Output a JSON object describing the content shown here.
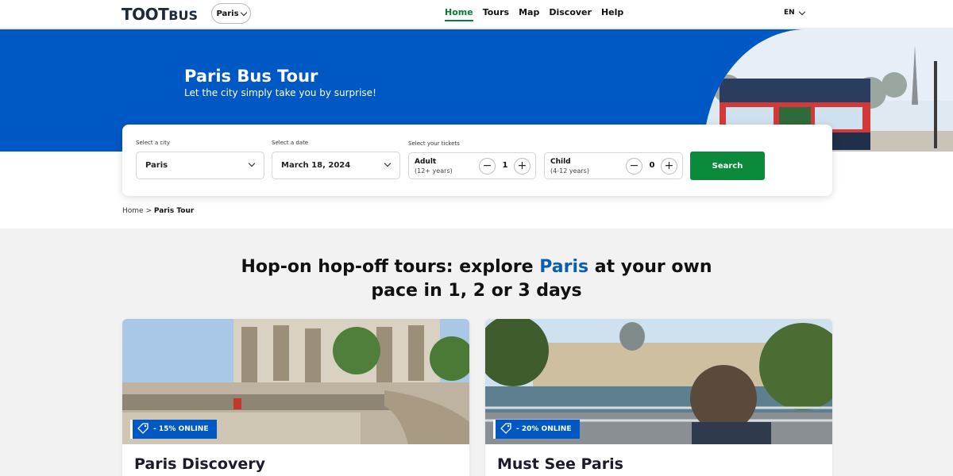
{
  "header": {
    "logo": "TOOTBUS",
    "logo_main": "TOOT",
    "logo_sub": "BUS",
    "city_selector": "Paris",
    "nav": [
      "Home",
      "Tours",
      "Map",
      "Discover",
      "Help"
    ],
    "active_nav": "Home",
    "language": "EN"
  },
  "hero": {
    "title": "Paris Bus Tour",
    "subtitle": "Let the city simply take you by surprise!"
  },
  "search": {
    "city_label": "Select a city",
    "city_value": "Paris",
    "date_label": "Select a date",
    "date_value": "March 18, 2024",
    "tickets_label": "Select your tickets",
    "adult_label": "Adult",
    "adult_age": "(12+ years)",
    "adult_count": "1",
    "child_label": "Child",
    "child_age": "(4-12 years)",
    "child_count": "0",
    "button": "Search"
  },
  "breadcrumb": {
    "home": "Home",
    "separator": ">",
    "current": "Paris Tour"
  },
  "main": {
    "heading_before": "Hop-on hop-off tours: explore",
    "heading_city": "Paris",
    "heading_after": "at your own pace in 1, 2 or 3 days"
  },
  "cards": [
    {
      "title": "Paris Discovery",
      "badge": "- 15% ONLINE"
    },
    {
      "title": "Must See Paris",
      "badge": "- 20% ONLINE"
    }
  ],
  "colors": {
    "brand_blue": "#0058c4",
    "cta_green": "#0a8a3a",
    "active_nav": "#0a7a3c",
    "city_highlight": "#0a5fb0"
  },
  "icons": [
    "chevron-down-icon",
    "minus-icon",
    "plus-icon",
    "tag-icon"
  ]
}
